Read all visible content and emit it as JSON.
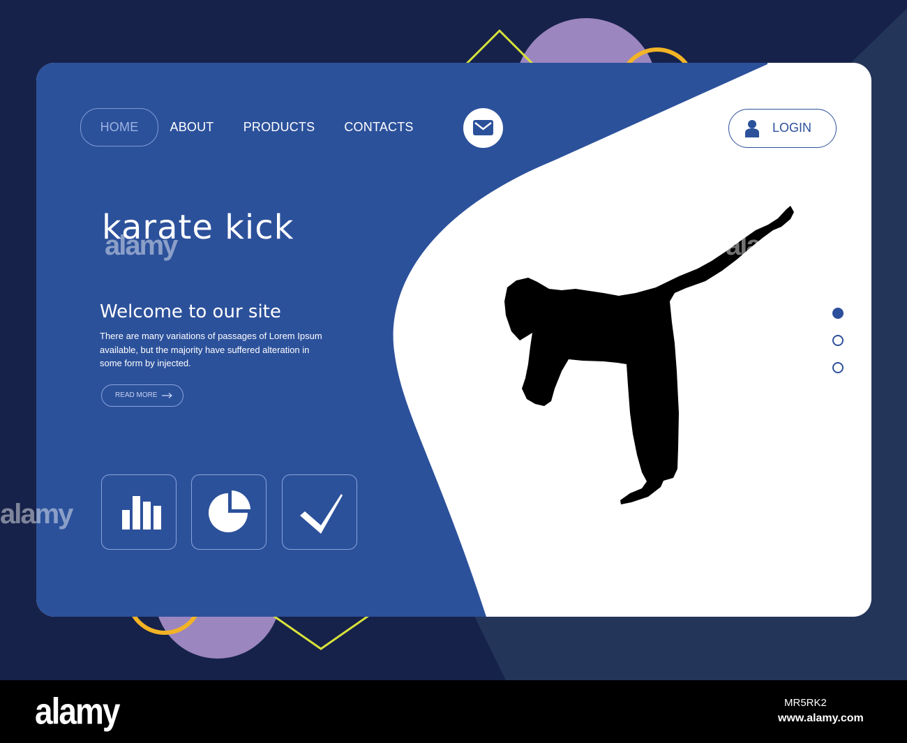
{
  "nav": {
    "items": [
      {
        "label": "HOME",
        "active": true
      },
      {
        "label": "ABOUT"
      },
      {
        "label": "PRODUCTS"
      },
      {
        "label": "CONTACTS"
      }
    ],
    "mail_icon": "envelope-icon",
    "login": {
      "label": "LOGIN",
      "icon": "user-icon"
    }
  },
  "hero": {
    "title": "karate kick",
    "subtitle": "Welcome to our site",
    "description": "There are many variations of passages of Lorem Ipsum available, but the majority have suffered alteration in some form by injected.",
    "read_more": "READ MORE",
    "image": "karate-kick-silhouette"
  },
  "features": [
    {
      "icon": "bar-chart-icon"
    },
    {
      "icon": "pie-chart-icon"
    },
    {
      "icon": "checkmark-icon"
    }
  ],
  "pagination": {
    "count": 3,
    "active_index": 0
  },
  "watermark": {
    "logo": "alamy",
    "image_id": "MR5RK2",
    "url": "www.alamy.com",
    "mark": "alamy"
  },
  "colors": {
    "background": "#16224a",
    "card_blue": "#2c519b",
    "card_white": "#ffffff",
    "accent_purple": "#9c86bf",
    "accent_yellow": "#f2b426",
    "accent_lime": "#d8e23a"
  }
}
